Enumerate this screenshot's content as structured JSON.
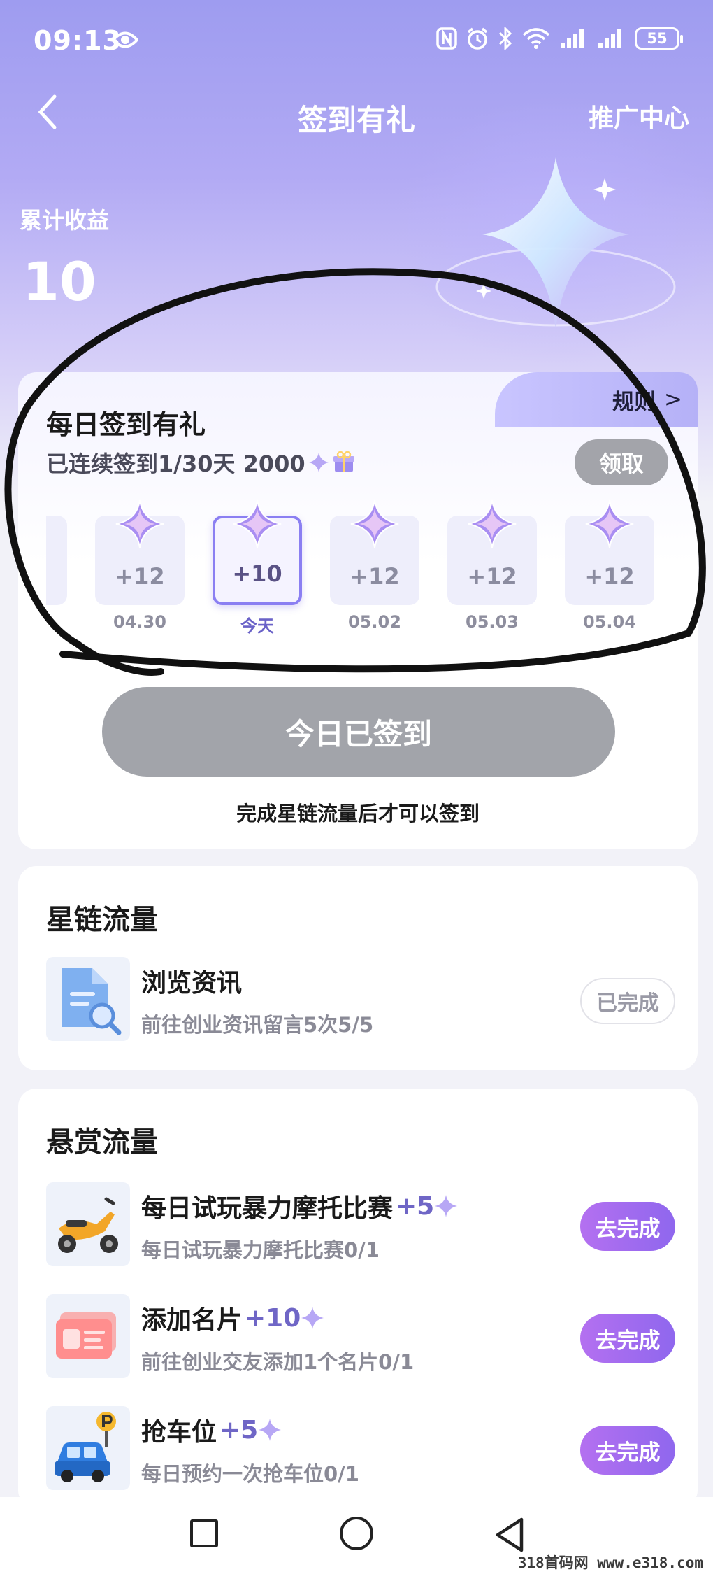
{
  "status_bar": {
    "time": "09:13",
    "battery": "55"
  },
  "header": {
    "title": "签到有礼",
    "promo_link": "推广中心"
  },
  "earnings": {
    "label": "累计收益",
    "value": "10"
  },
  "signin": {
    "title": "每日签到有礼",
    "rules_label": "规则",
    "streak_text": "已连续签到1/30天 2000",
    "claim_label": "领取",
    "days": [
      {
        "points": "+12",
        "date": "04.30",
        "today": false
      },
      {
        "points": "+10",
        "date": "今天",
        "today": true
      },
      {
        "points": "+12",
        "date": "05.02",
        "today": false
      },
      {
        "points": "+12",
        "date": "05.03",
        "today": false
      },
      {
        "points": "+12",
        "date": "05.04",
        "today": false
      }
    ],
    "signed_button": "今日已签到",
    "hint": "完成星链流量后才可以签到"
  },
  "starlink": {
    "title": "星链流量",
    "tasks": [
      {
        "title": "浏览资讯",
        "reward": "",
        "desc": "前往创业资讯留言5次5/5",
        "action": "已完成"
      }
    ]
  },
  "bounty": {
    "title": "悬赏流量",
    "tasks": [
      {
        "title": "每日试玩暴力摩托比赛",
        "reward": "+5",
        "desc": "每日试玩暴力摩托比赛0/1",
        "action": "去完成"
      },
      {
        "title": "添加名片",
        "reward": "+10",
        "desc": "前往创业交友添加1个名片0/1",
        "action": "去完成"
      },
      {
        "title": "抢车位",
        "reward": "+5",
        "desc": "每日预约一次抢车位0/1",
        "action": "去完成"
      }
    ]
  },
  "watermark": "318首码网 www.e318.com",
  "colors": {
    "accent": "#8b7ff2",
    "action_gradient_start": "#b470f0",
    "action_gradient_end": "#8f67ee",
    "disabled": "#a2a4aa"
  },
  "icons": [
    "eye-icon",
    "nfc-icon",
    "alarm-icon",
    "bluetooth-icon",
    "wifi-icon",
    "signal-icon",
    "back-icon",
    "star-icon",
    "gift-icon",
    "document-search-icon",
    "scooter-icon",
    "business-card-icon",
    "parking-car-icon"
  ]
}
